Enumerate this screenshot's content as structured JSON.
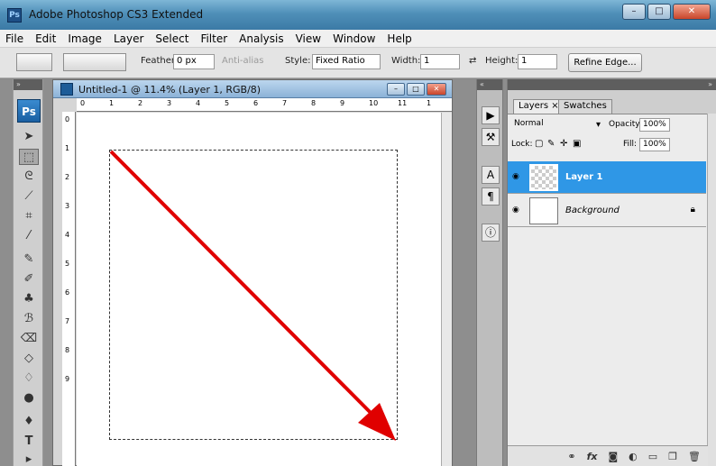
{
  "window": {
    "title": "Adobe Photoshop CS3 Extended",
    "app_icon": "Ps"
  },
  "menu": [
    "File",
    "Edit",
    "Image",
    "Layer",
    "Select",
    "Filter",
    "Analysis",
    "View",
    "Window",
    "Help"
  ],
  "options": {
    "feather_label": "Feather:",
    "feather_value": "0 px",
    "antialias_label": "Anti-alias",
    "style_label": "Style:",
    "style_value": "Fixed Ratio",
    "width_label": "Width:",
    "width_value": "1",
    "height_label": "Height:",
    "height_value": "1",
    "refine_edge": "Refine Edge..."
  },
  "tools": {
    "logo": "Ps"
  },
  "document": {
    "title": "Untitled-1 @ 11.4% (Layer 1, RGB/8)",
    "hruler": [
      "0",
      "1",
      "2",
      "3",
      "4",
      "5",
      "6",
      "7",
      "8",
      "9",
      "10",
      "11",
      "1"
    ],
    "vruler": [
      "0",
      "1",
      "2",
      "3",
      "4",
      "5",
      "6",
      "7",
      "8",
      "9"
    ]
  },
  "layers_panel": {
    "tabs": [
      "Layers ×",
      "Swatches"
    ],
    "blend_mode": "Normal",
    "opacity_label": "Opacity:",
    "opacity_value": "100%",
    "lock_label": "Lock:",
    "fill_label": "Fill:",
    "fill_value": "100%",
    "layers": [
      {
        "name": "Layer 1",
        "selected": true
      },
      {
        "name": "Background",
        "selected": false
      }
    ]
  },
  "colors": {
    "accent": "#2f97e6",
    "arrow": "#e00000"
  }
}
